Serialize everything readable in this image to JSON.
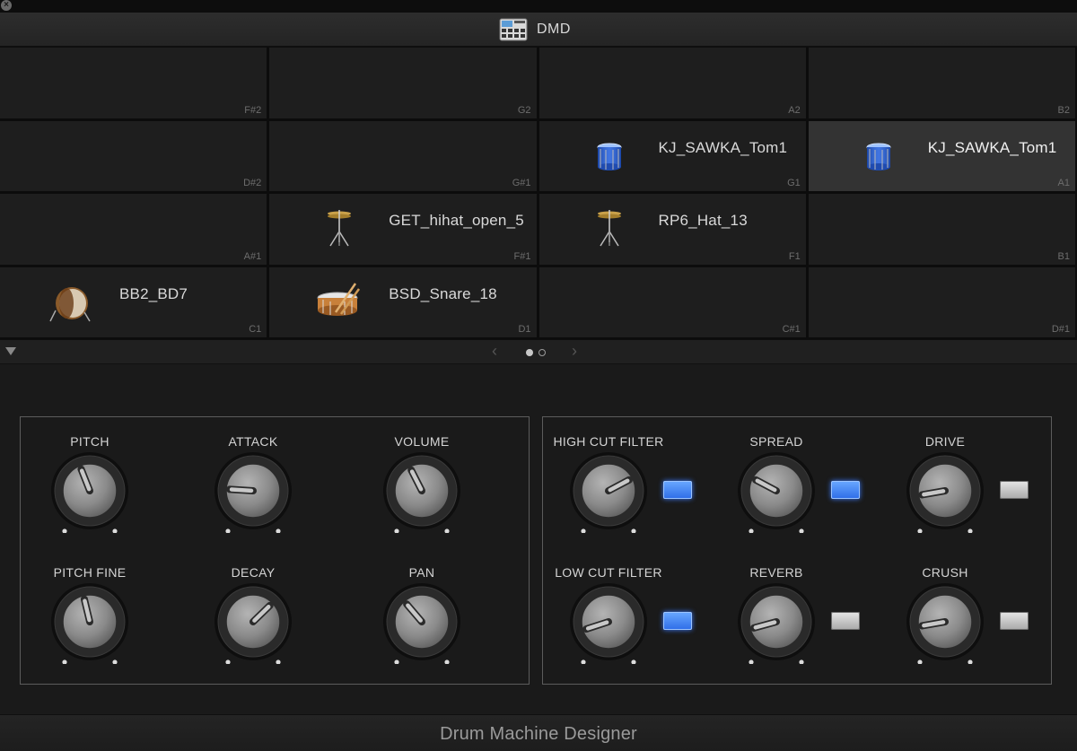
{
  "window": {
    "close_icon": "close-icon",
    "close_glyph": "×"
  },
  "title": {
    "text": "DMD",
    "icon": "drum-machine-icon"
  },
  "pads": [
    {
      "name": "",
      "note": "F#2",
      "icon": "",
      "selected": false
    },
    {
      "name": "",
      "note": "G2",
      "icon": "",
      "selected": false
    },
    {
      "name": "",
      "note": "A2",
      "icon": "",
      "selected": false
    },
    {
      "name": "",
      "note": "B2",
      "icon": "",
      "selected": false
    },
    {
      "name": "",
      "note": "D#2",
      "icon": "",
      "selected": false
    },
    {
      "name": "",
      "note": "G#1",
      "icon": "",
      "selected": false
    },
    {
      "name": "KJ_SAWKA_Tom1",
      "note": "G1",
      "icon": "tom",
      "selected": false
    },
    {
      "name": "KJ_SAWKA_Tom1",
      "note": "A1",
      "icon": "tom",
      "selected": true
    },
    {
      "name": "",
      "note": "A#1",
      "icon": "",
      "selected": false
    },
    {
      "name": "GET_hihat_open_5",
      "note": "F#1",
      "icon": "hihat",
      "selected": false
    },
    {
      "name": "RP6_Hat_13",
      "note": "F1",
      "icon": "hihat",
      "selected": false
    },
    {
      "name": "",
      "note": "B1",
      "icon": "",
      "selected": false
    },
    {
      "name": "BB2_BD7",
      "note": "C1",
      "icon": "kick",
      "selected": false
    },
    {
      "name": "BSD_Snare_18",
      "note": "D1",
      "icon": "snare",
      "selected": false
    },
    {
      "name": "",
      "note": "C#1",
      "icon": "",
      "selected": false
    },
    {
      "name": "",
      "note": "D#1",
      "icon": "",
      "selected": false
    }
  ],
  "pager": {
    "prev_glyph": "‹",
    "next_glyph": "›",
    "current_page": 1,
    "page_count": 2
  },
  "knobs": [
    {
      "label": "PITCH",
      "value": 0.42,
      "toggle": null
    },
    {
      "label": "ATTACK",
      "value": 0.18,
      "toggle": null
    },
    {
      "label": "VOLUME",
      "value": 0.4,
      "toggle": null
    },
    {
      "label": "PITCH FINE",
      "value": 0.45,
      "toggle": null
    },
    {
      "label": "DECAY",
      "value": 0.67,
      "toggle": null
    },
    {
      "label": "PAN",
      "value": 0.35,
      "toggle": null
    },
    {
      "label": "HIGH CUT FILTER",
      "value": 0.73,
      "toggle": "on"
    },
    {
      "label": "SPREAD",
      "value": 0.27,
      "toggle": "on"
    },
    {
      "label": "DRIVE",
      "value": 0.13,
      "toggle": "off"
    },
    {
      "label": "LOW CUT FILTER",
      "value": 0.1,
      "toggle": "on"
    },
    {
      "label": "REVERB",
      "value": 0.11,
      "toggle": "off"
    },
    {
      "label": "CRUSH",
      "value": 0.13,
      "toggle": "off"
    }
  ],
  "colors": {
    "toggle_on": "#3c7cff",
    "pad_selected": "#333333",
    "pad": "#1e1e1e"
  },
  "footer": {
    "text": "Drum Machine Designer"
  }
}
